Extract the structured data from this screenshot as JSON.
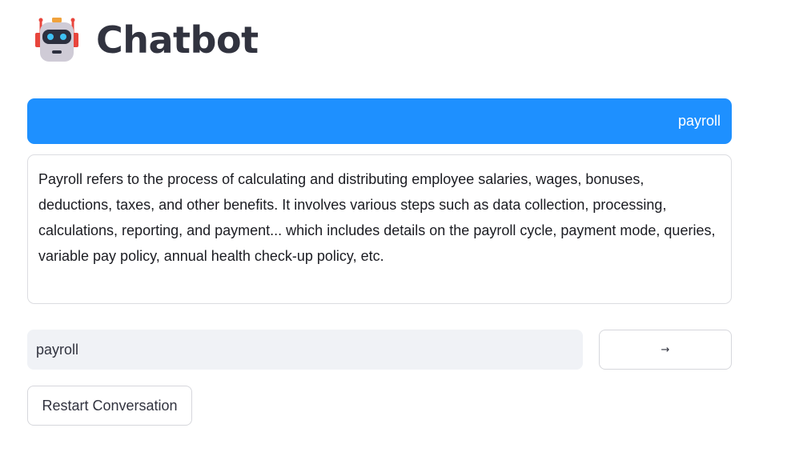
{
  "header": {
    "title": "Chatbot",
    "icon": "robot-icon"
  },
  "messages": [
    {
      "role": "user",
      "text": "payroll",
      "color": "#1e90ff"
    },
    {
      "role": "assistant",
      "text": "Payroll refers to the process of calculating and distributing employee salaries, wages, bonuses, deductions, taxes, and other benefits. It involves various steps such as data collection, processing, calculations, reporting, and payment... which includes details on the payroll cycle, payment mode, queries, variable pay policy, annual health check-up policy, etc."
    }
  ],
  "input": {
    "value": "payroll"
  },
  "send_button": {
    "label": "→",
    "icon": "arrow-right-icon"
  },
  "restart_button": {
    "label": "Restart Conversation"
  }
}
